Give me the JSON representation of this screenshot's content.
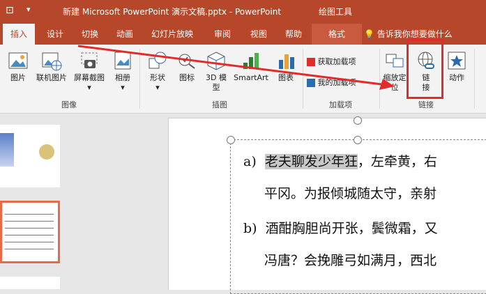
{
  "titlebar": {
    "title": "新建 Microsoft PowerPoint 演示文稿.pptx  -  PowerPoint",
    "context_tools": "绘图工具"
  },
  "tabs": [
    {
      "label": "插入",
      "active": true
    },
    {
      "label": "设计"
    },
    {
      "label": "切换"
    },
    {
      "label": "动画"
    },
    {
      "label": "幻灯片放映"
    },
    {
      "label": "审阅"
    },
    {
      "label": "视图"
    },
    {
      "label": "帮助"
    },
    {
      "label": "格式"
    }
  ],
  "tell_me": "告诉我你想要做什么",
  "ribbon": {
    "images": {
      "picture": "图片",
      "online_picture": "联机图片",
      "screenshot": "屏幕截图",
      "album": "相册",
      "group": "图像"
    },
    "illustrations": {
      "shapes": "形状",
      "icons": "图标",
      "model3d_1": "3D 模",
      "model3d_2": "型",
      "smartart": "SmartArt",
      "chart": "图表",
      "group": "插图"
    },
    "addins": {
      "get": "获取加载项",
      "mine": "我的加载项",
      "group": "加载项"
    },
    "links": {
      "zoom_1": "缩放定",
      "zoom_2": "位",
      "link_1": "链",
      "link_2": "接",
      "action": "动作",
      "group": "链接"
    }
  },
  "slide": {
    "para_a": {
      "marker": "a)",
      "line1_hl": "老夫聊发少年狂",
      "line1_rest": "，左牵黄，右",
      "line2": "平冈。为报倾城随太守，亲射"
    },
    "para_b": {
      "marker": "b)",
      "line1": "酒酣胸胆尚开张，鬓微霜，又",
      "line2": "冯唐？会挽雕弓如满月，西北"
    }
  },
  "colors": {
    "accent": "#b7472a",
    "annotation": "#e22b2b"
  }
}
